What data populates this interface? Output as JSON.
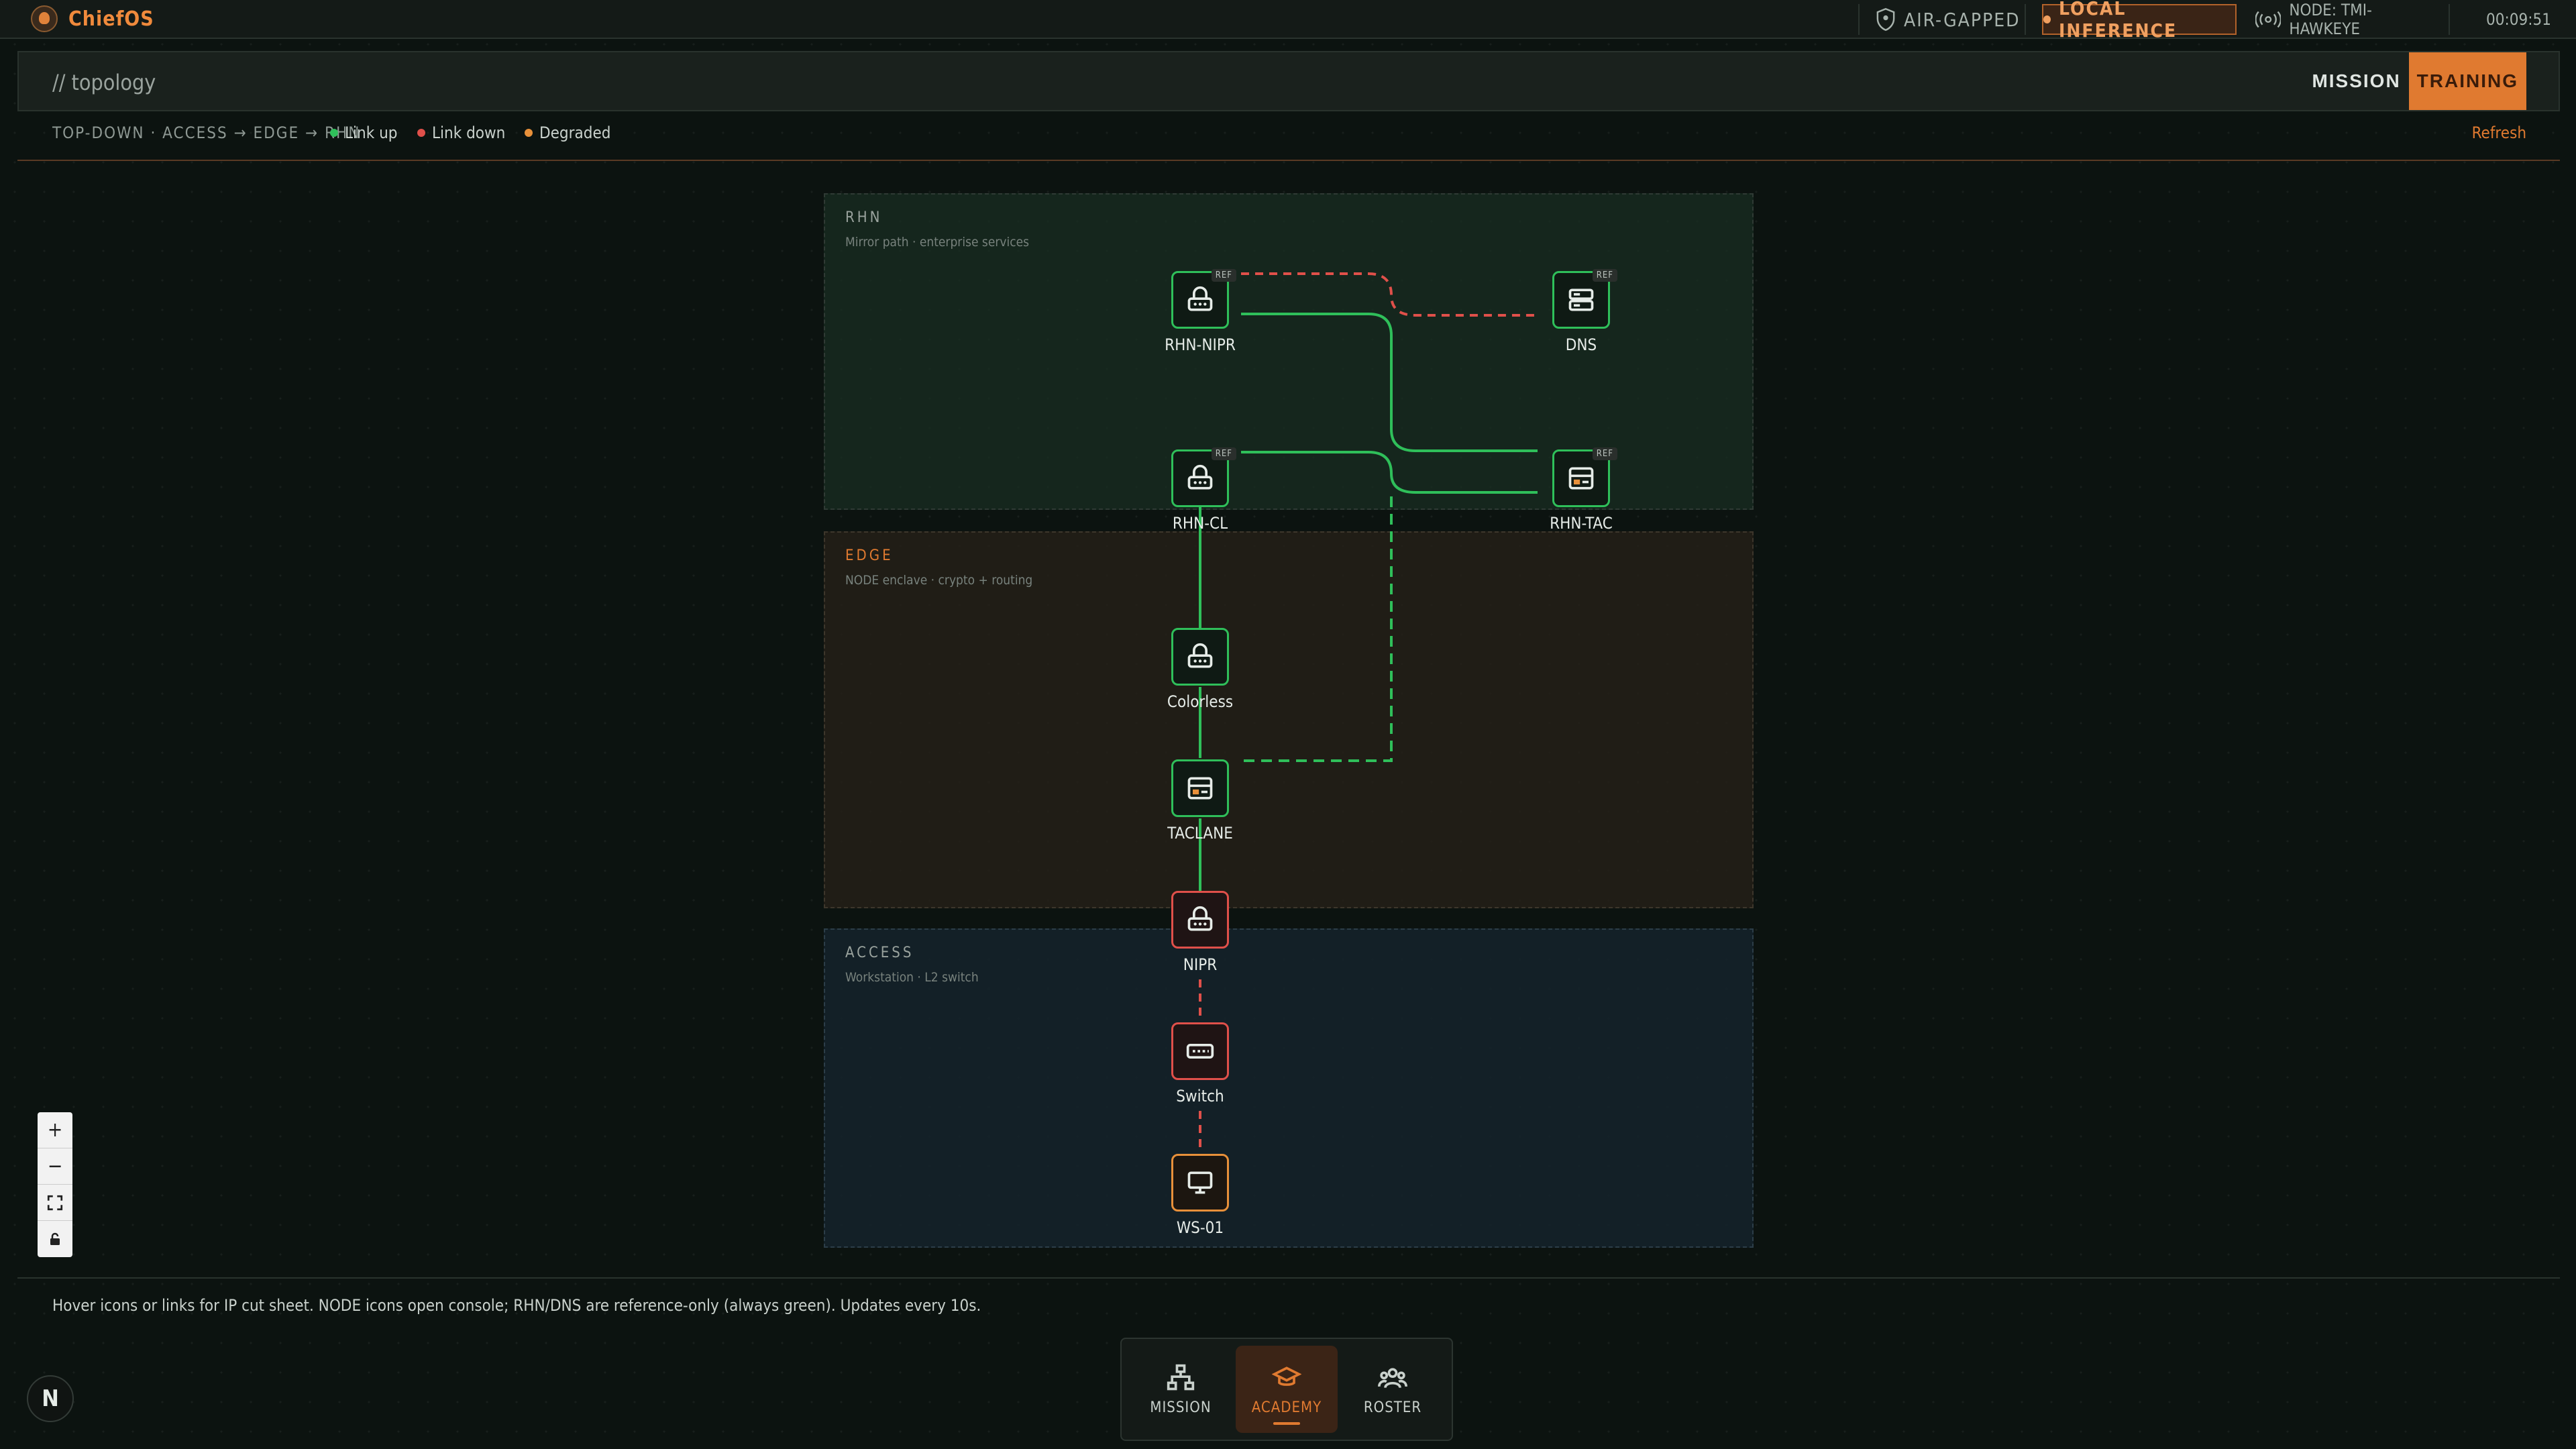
{
  "app": {
    "name": "ChiefOS"
  },
  "topbar": {
    "airgapped": "AIR-GAPPED",
    "inference": "LOCAL INFERENCE",
    "node": "NODE: TMI-HAWKEYE",
    "clock": "00:09:51"
  },
  "header": {
    "title": "// topology",
    "mode_mission": "MISSION",
    "mode_training": "TRAINING"
  },
  "legend": {
    "path": "TOP-DOWN · ACCESS → EDGE → RHN",
    "up": "Link up",
    "down": "Link down",
    "degraded": "Degraded",
    "refresh": "Refresh"
  },
  "colors": {
    "up": "#2fbf5a",
    "down": "#e0504a",
    "degraded": "#e8903a",
    "accent": "#e07a30"
  },
  "zones": {
    "rhn": {
      "title": "RHN",
      "subtitle": "Mirror path · enterprise services"
    },
    "edge": {
      "title": "EDGE",
      "subtitle": "NODE enclave · crypto + routing"
    },
    "access": {
      "title": "ACCESS",
      "subtitle": "Workstation · L2 switch"
    }
  },
  "nodes": {
    "rhn_nipr": {
      "label": "RHN-NIPR",
      "icon": "router-icon",
      "ref": "REF",
      "status": "up"
    },
    "dns": {
      "label": "DNS",
      "icon": "server-icon",
      "ref": "REF",
      "status": "up"
    },
    "rhn_cl": {
      "label": "RHN-CL",
      "icon": "router-icon",
      "ref": "REF",
      "status": "up"
    },
    "rhn_tac": {
      "label": "RHN-TAC",
      "icon": "crypto-icon",
      "ref": "REF",
      "status": "up"
    },
    "colorless": {
      "label": "Colorless",
      "icon": "router-icon",
      "status": "up"
    },
    "taclane": {
      "label": "TACLANE",
      "icon": "crypto-icon",
      "status": "up"
    },
    "nipr": {
      "label": "NIPR",
      "icon": "router-icon",
      "status": "down"
    },
    "switch": {
      "label": "Switch",
      "icon": "switch-icon",
      "status": "down"
    },
    "ws01": {
      "label": "WS-01",
      "icon": "monitor-icon",
      "status": "degraded"
    }
  },
  "zoom": {
    "in": "+",
    "out": "−"
  },
  "footer": {
    "note": "Hover icons or links for IP cut sheet. NODE icons open console; RHN/DNS are reference-only (always green). Updates every 10s."
  },
  "dock": {
    "mission": "MISSION",
    "academy": "ACADEMY",
    "roster": "ROSTER"
  },
  "badge": "N"
}
